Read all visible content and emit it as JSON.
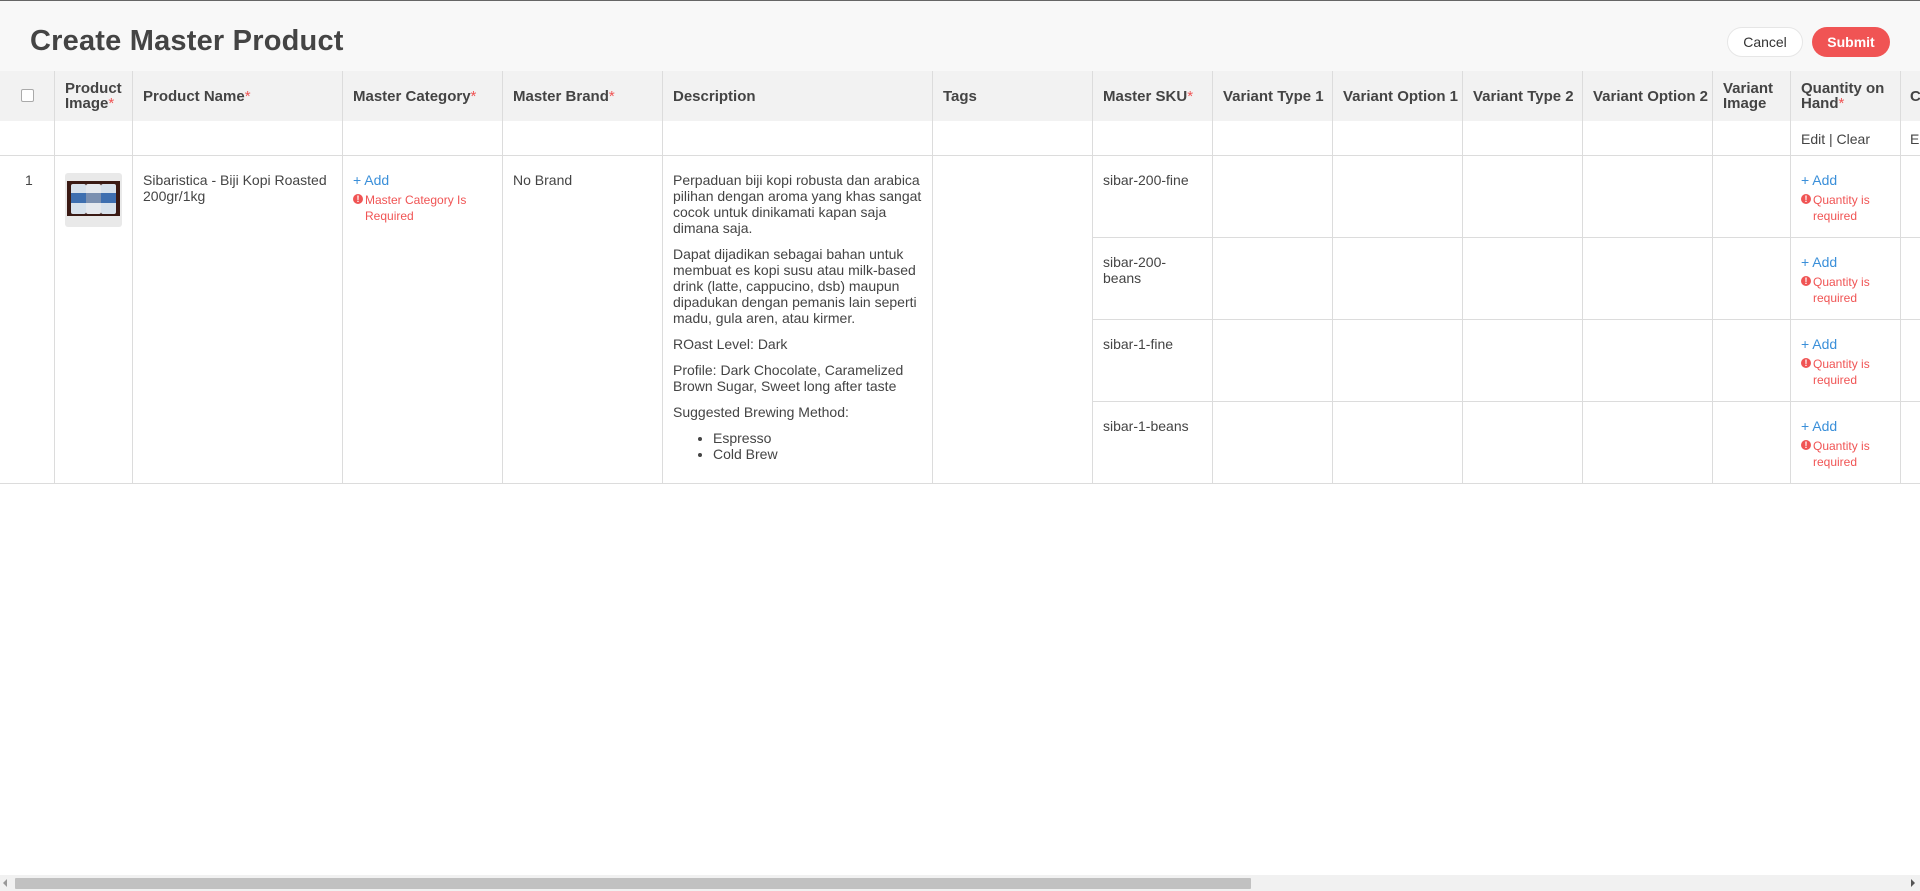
{
  "page": {
    "title": "Create Master Product"
  },
  "actions": {
    "cancel_label": "Cancel",
    "submit_label": "Submit"
  },
  "columns": {
    "product_image": "Product Image",
    "product_name": "Product Name",
    "master_category": "Master Category",
    "master_brand": "Master Brand",
    "description": "Description",
    "tags": "Tags",
    "master_sku": "Master SKU",
    "variant_type_1": "Variant Type 1",
    "variant_option_1": "Variant Option 1",
    "variant_type_2": "Variant Type 2",
    "variant_option_2": "Variant Option 2",
    "variant_image": "Variant Image",
    "quantity_on_hand": "Quantity on Hand",
    "next_col_partial": "C",
    "required_mark": "*"
  },
  "bulk_edit": {
    "edit_label": "Edit",
    "separator": "|",
    "clear_label": "Clear",
    "next_edit_partial": "E"
  },
  "row": {
    "number": "1",
    "product_name": "Sibaristica - Biji Kopi Roasted 200gr/1kg",
    "add_label": "+ Add",
    "category_error": "Master Category Is Required",
    "brand": "No Brand",
    "description": {
      "p1": "Perpaduan biji kopi robusta dan arabica pilihan dengan aroma yang khas sangat cocok untuk dinikamati kapan saja dimana saja.",
      "p2": "Dapat dijadikan sebagai bahan untuk membuat es kopi susu atau milk-based drink (latte, cappucino, dsb) maupun dipadukan dengan pemanis lain seperti madu, gula aren, atau kirmer.",
      "p3": "ROast Level: Dark",
      "p4": "Profile: Dark Chocolate, Caramelized Brown Sugar, Sweet long after taste",
      "p5": "Suggested Brewing Method:",
      "methods": [
        "Espresso",
        "Cold Brew"
      ]
    }
  },
  "variants": [
    {
      "sku": "sibar-200-fine",
      "add_label": "+ Add",
      "error": "Quantity is required"
    },
    {
      "sku": "sibar-200-beans",
      "add_label": "+ Add",
      "error": "Quantity is required"
    },
    {
      "sku": "sibar-1-fine",
      "add_label": "+ Add",
      "error": "Quantity is required"
    },
    {
      "sku": "sibar-1-beans",
      "add_label": "+ Add",
      "error": "Quantity is required"
    }
  ],
  "colors": {
    "accent": "#f05454",
    "link": "#3a8fd9",
    "header_bg": "#f2f2f2"
  },
  "icons": {
    "error": "exclamation-circle-icon",
    "checkbox": "checkbox-icon"
  }
}
